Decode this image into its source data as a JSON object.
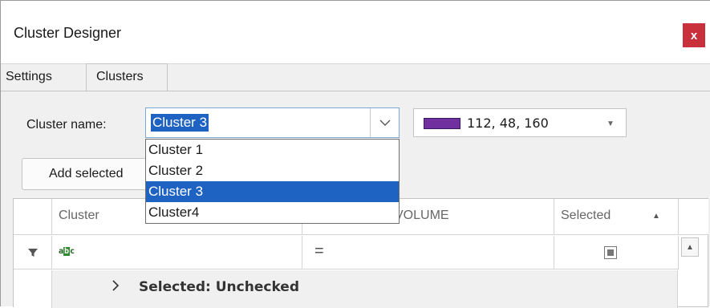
{
  "window": {
    "title": "Cluster Designer",
    "close_label": "x"
  },
  "tabs": [
    {
      "label": "Settings"
    },
    {
      "label": "Clusters"
    }
  ],
  "cluster_name": {
    "label": "Cluster name:",
    "value": "Cluster 3",
    "dropdown_options": [
      "Cluster 1",
      "Cluster 2",
      "Cluster 3",
      "Cluster4"
    ],
    "selected_index": 2
  },
  "color_picker": {
    "rgb_text": "112, 48, 160",
    "swatch_color": "#7030a0"
  },
  "add_button": {
    "label": "Add selected"
  },
  "grid": {
    "columns": [
      "Cluster",
      "VOLUME",
      "Selected"
    ],
    "filter_row": {
      "cluster_icon": "abc-icon",
      "volume_operator": "=",
      "selected_icon": "checkbox-indeterminate-icon"
    },
    "group_row": {
      "label": "Selected: Unchecked"
    }
  },
  "icons": {
    "dropdown": "chevron-down-icon",
    "filter": "filter-icon",
    "sort": "sort-up-icon",
    "scroll": "scroll-up-icon",
    "expand": "chevron-right-icon"
  }
}
